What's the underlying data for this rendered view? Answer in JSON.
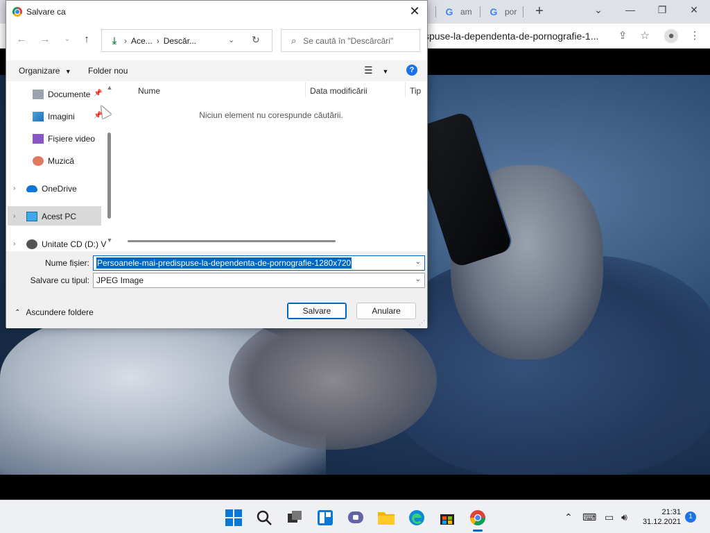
{
  "browser": {
    "tabs": [
      {
        "label": "am"
      },
      {
        "label": "por"
      }
    ],
    "new_tab_label": "+",
    "url": "spuse-la-dependenta-de-pornografie-1..."
  },
  "dialog": {
    "title": "Salvare ca",
    "address": {
      "crumbs": [
        "Ace...",
        "Descăr..."
      ]
    },
    "search_placeholder": "Se caută în \"Descărcări\"",
    "commands": {
      "organize": "Organizare",
      "new_folder": "Folder nou"
    },
    "nav_items": [
      {
        "label": "Documente",
        "icon": "documents-icon",
        "pinned": true
      },
      {
        "label": "Imagini",
        "icon": "pictures-icon",
        "pinned": true
      },
      {
        "label": "Fișiere video",
        "icon": "videos-icon"
      },
      {
        "label": "Muzică",
        "icon": "music-icon"
      },
      {
        "label": "OneDrive",
        "icon": "onedrive-icon"
      },
      {
        "label": "Acest PC",
        "icon": "this-pc-icon",
        "selected": true
      },
      {
        "label": "Unitate CD (D:) V",
        "icon": "cd-drive-icon"
      }
    ],
    "columns": [
      "Nume",
      "Data modificării",
      "Tip"
    ],
    "empty_message": "Niciun element nu corespunde căutării.",
    "file_name_label": "Nume fișier:",
    "file_name_value": "Persoanele-mai-predispuse-la-dependenta-de-pornografie-1280x720",
    "save_type_label": "Salvare cu tipul:",
    "save_type_value": "JPEG Image",
    "hide_folders_label": "Ascundere foldere",
    "save_button": "Salvare",
    "cancel_button": "Anulare"
  },
  "taskbar": {
    "time": "21:31",
    "date": "31.12.2021",
    "notification_count": "1"
  },
  "colors": {
    "accent": "#0067c0",
    "selection": "#0067c0",
    "help": "#1a73e8"
  }
}
